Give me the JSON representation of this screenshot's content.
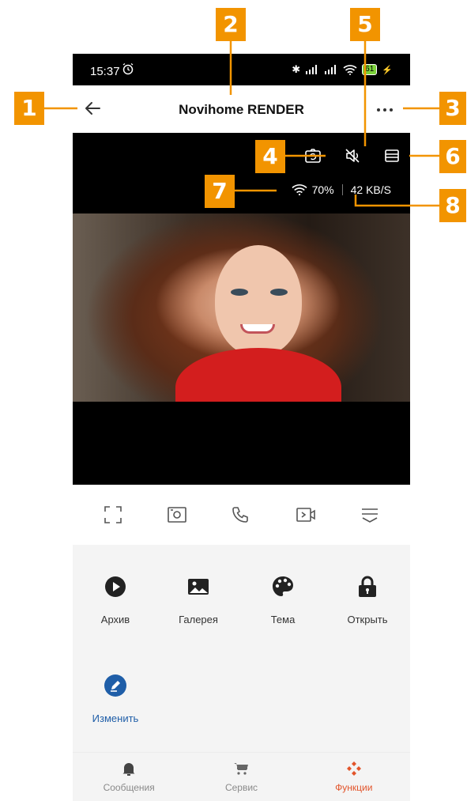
{
  "status_bar": {
    "time": "15:37",
    "battery": "61"
  },
  "header": {
    "title": "Novihome RENDER",
    "back_icon": "arrow-left-icon",
    "more_icon": "more-dots-icon"
  },
  "video": {
    "tools": [
      "snapshot-icon",
      "mute-icon",
      "layout-icon"
    ],
    "signal_strength": "70%",
    "bitrate": "42 KB/S"
  },
  "controls": [
    "fullscreen-icon",
    "record-icon",
    "call-icon",
    "video-play-icon",
    "collapse-icon"
  ],
  "functions": [
    {
      "label": "Архив",
      "icon": "play-circle-icon"
    },
    {
      "label": "Галерея",
      "icon": "image-icon"
    },
    {
      "label": "Тема",
      "icon": "palette-icon"
    },
    {
      "label": "Открыть",
      "icon": "lock-icon"
    },
    {
      "label": "Изменить",
      "icon": "edit-icon"
    }
  ],
  "bottom_nav": [
    {
      "label": "Сообщения",
      "icon": "bell-icon"
    },
    {
      "label": "Сервис",
      "icon": "cart-icon"
    },
    {
      "label": "Функции",
      "icon": "functions-icon",
      "active": true
    }
  ],
  "callouts": [
    "1",
    "2",
    "3",
    "4",
    "5",
    "6",
    "7",
    "8"
  ],
  "colors": {
    "accent": "#e2542a",
    "callout": "#f29400",
    "link": "#1f5ea8"
  }
}
